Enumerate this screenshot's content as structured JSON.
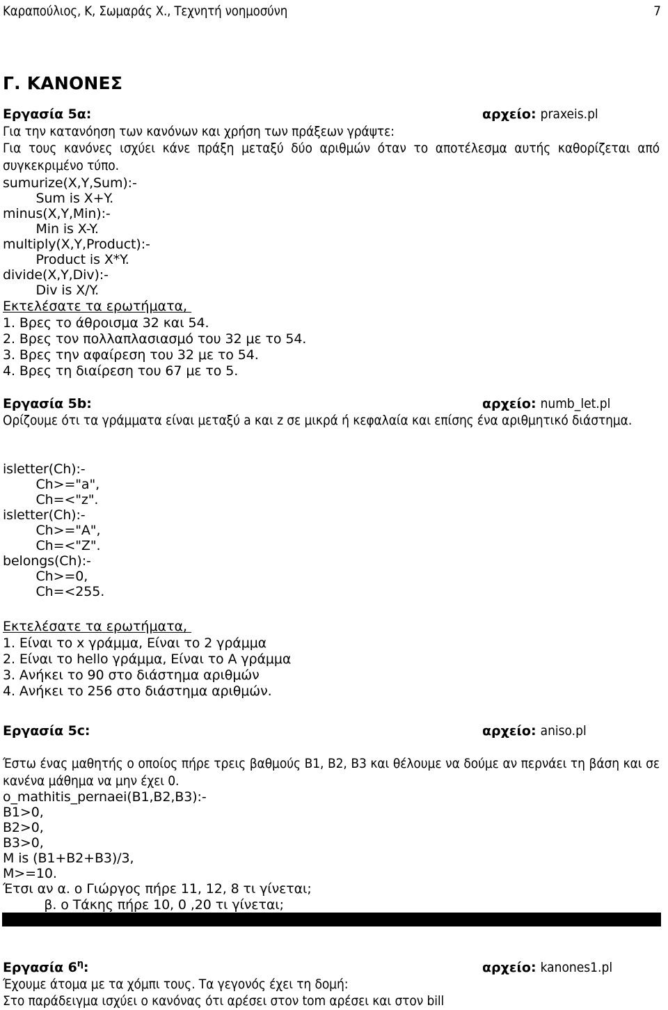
{
  "header": {
    "authors": "Καραπούλιος, Κ, Σωμαράς Χ., Τεχνητή νοημοσύνη",
    "page_number": "7"
  },
  "section": {
    "heading": "Γ. ΚΑΝΟΝΕΣ"
  },
  "file_key": "αρχείο:",
  "tasks": [
    {
      "label": "Εργασία 5α:",
      "file_value": "praxeis.pl",
      "intro_lines": [
        "Για την κατανόηση των κανόνων και χρήση των πράξεων γράψτε:"
      ],
      "paragraph": "Για τους κανόνες ισχύει κάνε πράξη μεταξύ δύο αριθμών όταν το αποτέλεσμα αυτής καθορίζεται από συγκεκριμένο τύπο.",
      "code": [
        "sumurize(X,Y,Sum):-",
        "        Sum is X+Y.",
        "minus(X,Y,Min):-",
        "        Min is X-Y.",
        "multiply(X,Y,Product):-",
        "        Product is X*Y.",
        "divide(X,Y,Div):-",
        "        Div is X/Y."
      ],
      "questions_head": "Εκτελέσατε τα ερωτήματα, ",
      "questions": [
        "1. Βρες το άθροισμα 32 και 54.",
        "2. Βρες τον πολλαπλασιασμό του 32 με το 54.",
        "3. Βρες την αφαίρεση του 32 με το 54.",
        "4. Βρες τη διαίρεση του 67 με το 5."
      ]
    },
    {
      "label": "Εργασία 5b:",
      "file_value": "numb_let.pl",
      "paragraph": "Ορίζουμε ότι τα γράμματα είναι μεταξύ a και z σε μικρά ή κεφαλαία και επίσης ένα αριθμητικό διάστημα.",
      "code": [
        "isletter(Ch):-",
        "        Ch>=\"a\",",
        "        Ch=<\"z\".",
        "isletter(Ch):-",
        "        Ch>=\"A\",",
        "        Ch=<\"Z\".",
        "belongs(Ch):-",
        "        Ch>=0,",
        "        Ch=<255."
      ],
      "questions_head": "Εκτελέσατε τα ερωτήματα, ",
      "questions": [
        "1. Είναι το x γράμμα, Είναι το 2 γράμμα",
        "2. Είναι το hello γράμμα, Είναι το Α γράμμα",
        "3. Ανήκει το 90 στο διάστημα αριθμών",
        "4. Ανήκει το 256 στο διάστημα αριθμών."
      ]
    },
    {
      "label": "Εργασία 5c:",
      "file_value": "aniso.pl",
      "paragraph": "Έστω ένας μαθητής ο οποίος πήρε τρεις βαθμούς Β1, Β2, Β3 και θέλουμε να δούμε αν περνάει τη βάση και σε κανένα μάθημα να μην έχει 0.",
      "code": [
        "o_mathitis_pernaei(B1,B2,B3):-",
        "B1>0,",
        "B2>0,",
        "B3>0,",
        "M is (B1+B2+B3)/3,",
        "M>=10."
      ],
      "closing_lines": [
        "Έτσι αν α. ο Γιώργος πήρε 11, 12, 8 τι γίνεται;",
        "          β. ο Τάκης πήρε 10, 0 ,20 τι γίνεται;"
      ]
    },
    {
      "label": "Εργασία 6",
      "label_sup": "η",
      "label_tail": ":",
      "file_value": "kanones1.pl",
      "closing_lines": [
        "Έχουμε άτομα με τα χόμπι τους. Τα γεγονός έχει τη δομή:",
        "Στο παράδειγμα ισχύει ο κανόνας ότι αρέσει στον tom αρέσει και στον bill"
      ]
    }
  ],
  "divider": {
    "color": "#000000"
  }
}
